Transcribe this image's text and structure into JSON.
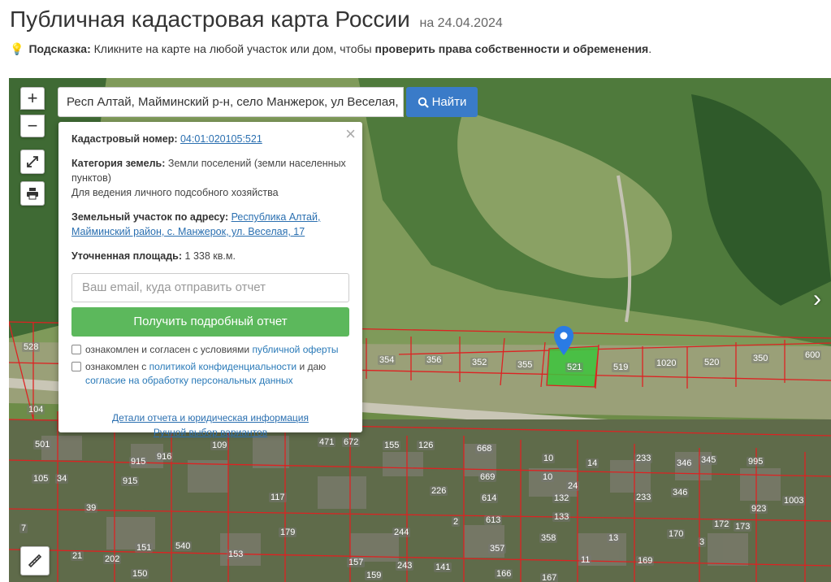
{
  "header": {
    "title": "Публичная кадастровая карта России",
    "date": "на 24.04.2024"
  },
  "hint": {
    "label": "Подсказка:",
    "text": "Кликните на карте на любой участок или дом, чтобы",
    "bold_text": "проверить права собственности и обременения",
    "end": "."
  },
  "search": {
    "value": "Респ Алтай, Майминский р-н, село Манжерок, ул Веселая,",
    "button_label": "Найти"
  },
  "controls": {
    "zoom_in": "+",
    "zoom_out": "−"
  },
  "popup": {
    "cadastral_label": "Кадастровый номер:",
    "cadastral_number": "04:01:020105:521",
    "category_label": "Категория земель:",
    "category_value": "Земли поселений (земли населенных пунктов)",
    "usage": "Для ведения личного подсобного хозяйства",
    "address_label": "Земельный участок по адресу:",
    "address_value": "Республика Алтай, Майминский район, с. Манжерок, ул. Веселая, 17",
    "area_label": "Уточненная площадь:",
    "area_value": "1 338 кв.м.",
    "email_placeholder": "Ваш email, куда отправить отчет",
    "report_button": "Получить подробный отчет",
    "check1_text": "ознакомлен и согласен с условиями",
    "check1_link": "публичной оферты",
    "check2_text": "ознакомлен с",
    "check2_link": "политикой конфиденциальности",
    "check2_text2": "и даю",
    "check2_link2": "согласие на обработку персональных данных",
    "details_link": "Детали отчета и юридическая информация",
    "manual_link": "Ручной выбор вариантов"
  },
  "parcels": {
    "row1": [
      "354",
      "356",
      "352",
      "355",
      "521",
      "519",
      "1020",
      "520",
      "350",
      "600"
    ],
    "left": [
      "528",
      "104",
      "501",
      "105",
      "34",
      "39",
      "21",
      "7"
    ],
    "south": [
      "109",
      "915",
      "916",
      "915",
      "117",
      "471",
      "672",
      "155",
      "126",
      "668",
      "669",
      "614",
      "613",
      "10",
      "10",
      "14",
      "233",
      "346",
      "345",
      "995",
      "226",
      "132",
      "133",
      "346",
      "233",
      "151",
      "540",
      "202",
      "179",
      "153",
      "244",
      "157",
      "159",
      "243",
      "357",
      "358",
      "169",
      "170",
      "172",
      "173",
      "923",
      "1003",
      "150",
      "141",
      "166",
      "167",
      "2",
      "3",
      "11",
      "13",
      "24"
    ]
  }
}
